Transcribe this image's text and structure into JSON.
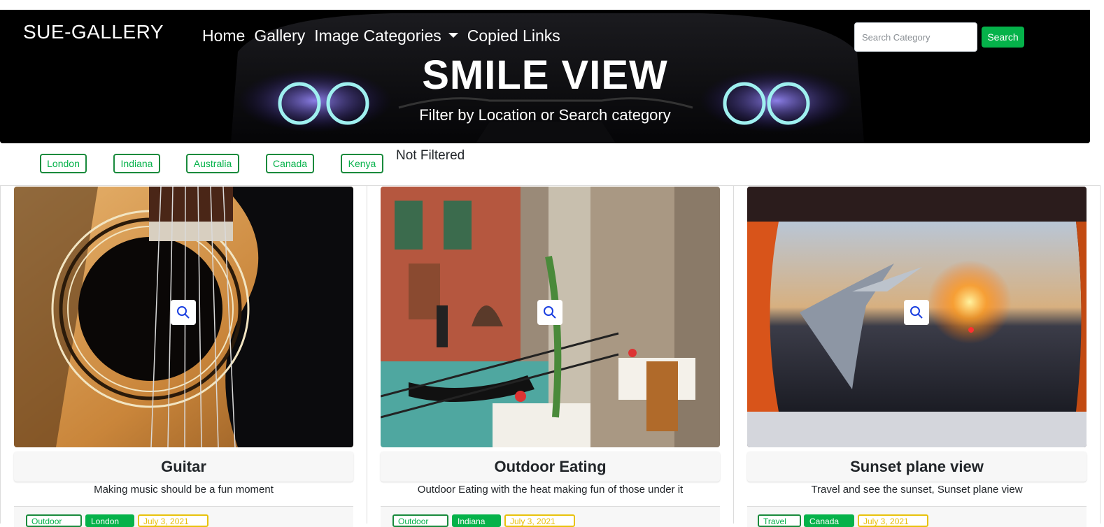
{
  "header": {
    "brand": "SUE-GALLERY",
    "nav": [
      "Home",
      "Gallery",
      "Image Categories",
      "Copied Links"
    ],
    "search": {
      "placeholder": "Search Category",
      "button": "Search"
    },
    "title": "SMILE VIEW",
    "subtitle": "Filter by Location or Search category"
  },
  "filters": {
    "locations": [
      "London",
      "Indiana",
      "Australia",
      "Canada",
      "Kenya"
    ],
    "status": "Not Filtered"
  },
  "cards": [
    {
      "title": "Guitar",
      "description": "Making music should be a fun moment",
      "tags": [
        "Outdoor",
        "London",
        "July 3, 2021"
      ]
    },
    {
      "title": "Outdoor Eating",
      "description": "Outdoor Eating with the heat making fun of those under it",
      "tags": [
        "Outdoor",
        "Indiana",
        "July 3, 2021"
      ]
    },
    {
      "title": "Sunset plane view",
      "description": "Travel and see the sunset, Sunset plane view",
      "tags": [
        "Travel",
        "Canada",
        "July 3, 2021"
      ]
    }
  ],
  "colors": {
    "accent": "#05b24a",
    "outline": "#198a3c",
    "date": "#e8c20c",
    "hero": "#000000"
  },
  "icons": {
    "card_overlay": "search-icon",
    "dropdown": "caret-down-icon"
  }
}
